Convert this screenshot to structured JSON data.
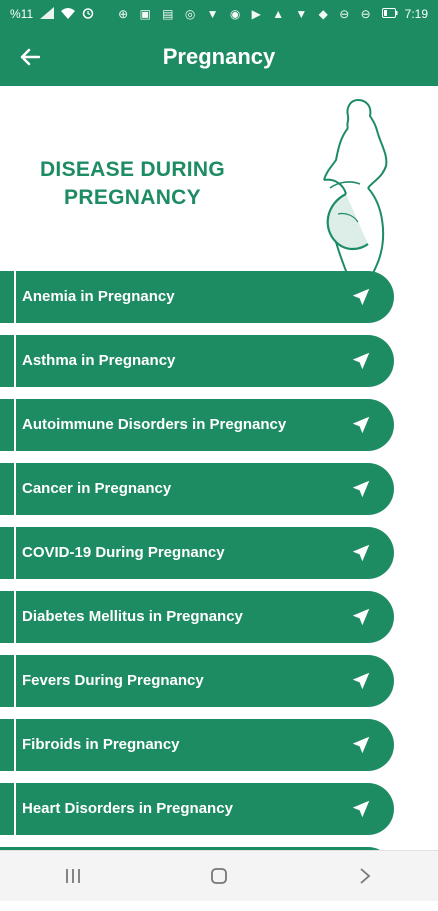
{
  "status_bar": {
    "left_text": "%11",
    "time": "7:19",
    "left_icons": [
      "signal-icon",
      "wifi-icon",
      "alarm-icon"
    ],
    "right_icons": [
      "usb-icon",
      "gallery-icon",
      "file-icon",
      "whatsapp-icon",
      "v-icon",
      "vpn-icon",
      "youtube-icon",
      "bell-icon",
      "v-icon",
      "telegram-icon",
      "minus-circle-icon",
      "minus-circle-icon"
    ]
  },
  "app_bar": {
    "title": "Pregnancy"
  },
  "hero": {
    "title": "DISEASE DURING PREGNANCY"
  },
  "diseases": [
    "Anemia in Pregnancy",
    "Asthma in Pregnancy",
    "Autoimmune Disorders in Pregnancy",
    "Cancer in Pregnancy",
    "COVID-19 During Pregnancy",
    "Diabetes Mellitus in Pregnancy",
    "Fevers During Pregnancy",
    "Fibroids in Pregnancy",
    "Heart Disorders in Pregnancy"
  ],
  "colors": {
    "primary": "#1e8c63",
    "text_on_primary": "#ffffff"
  }
}
